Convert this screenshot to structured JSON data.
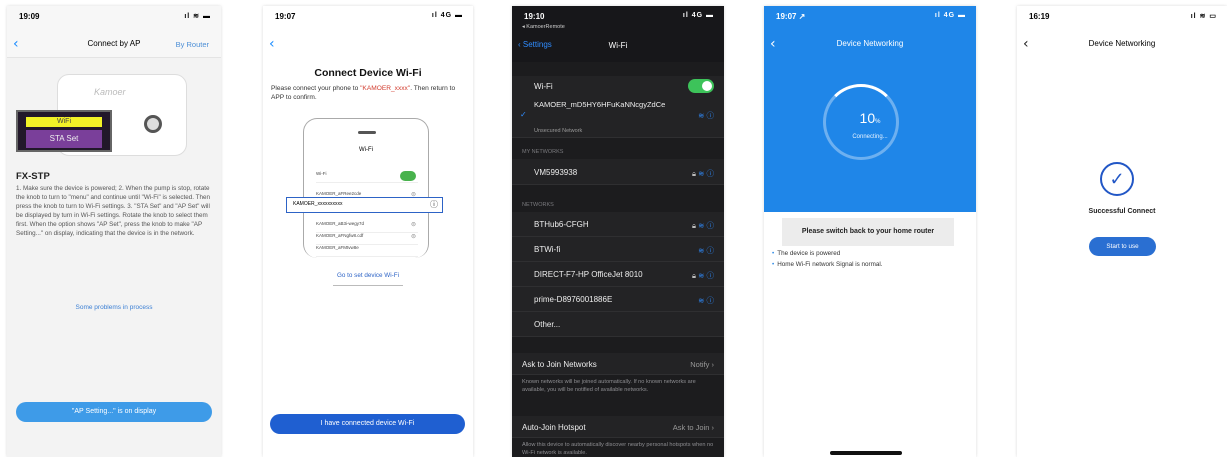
{
  "screen1": {
    "time": "19:09",
    "status_icons": "ıl ≋ ▬",
    "back": "‹",
    "title": "Connect by AP",
    "router_link": "By Router",
    "brand": "Kamoer",
    "lcd_wifi": "WiFi",
    "lcd_sta": "STA Set",
    "model": "FX-STP",
    "instructions": "1. Make sure the device is powered; 2. When the pump is stop, rotate the knob to turn to \"menu\" and continue until \"Wi-Fi\" is selected. Then press the knob to turn to Wi-Fi settings. 3. \"STA Set\" and \"AP Set\" will be displayed by turn in Wi-Fi settings. Rotate the knob to select them first. When the option shows \"AP Set\", press the knob to make \"AP Setting...\" on display, indicating that the device is in the network.",
    "problems_link": "Some problems in process",
    "button": "\"AP Setting...\" is on display"
  },
  "screen2": {
    "time": "19:07",
    "status_icons": "ıl 4G ▬",
    "back": "‹",
    "title": "Connect Device Wi-Fi",
    "desc_before": "Please connect your phone to ",
    "desc_red": "\"KAMOER_xxxx\"",
    "desc_after": ". Then return to APP to confirm.",
    "mock_title": "Wi-Fi",
    "mock_rows": [
      "Wi-Fi",
      "KAMOER_aFRee2cde",
      "KAMOER_aB3i-wegy7d",
      "KAMOER_aFNgfw8.cdf",
      "KAMOER_aFMtvw8e"
    ],
    "highlight_row": "KAMOER_xxxxxxxxxx",
    "go_link": "Go to set device Wi-Fi",
    "button": "I have connected device Wi-Fi"
  },
  "screen3": {
    "time": "19:10",
    "status_icons": "ıl 4G ▬",
    "remote": "◂ KamoerRemote",
    "settings": "‹ Settings",
    "title": "Wi-Fi",
    "wifi_label": "Wi-Fi",
    "connected_name": "KAMOER_mD5HY6HFuKaNNcgyZdCe",
    "connected_sub": "Unsecured Network",
    "my_networks_header": "MY NETWORKS",
    "my_networks": [
      "VM5993938"
    ],
    "networks_header": "NETWORKS",
    "networks": [
      "BTHub6-CFGH",
      "BTWi-fi",
      "DIRECT-F7-HP OfficeJet 8010",
      "prime-D8976001886E",
      "Other..."
    ],
    "ask_join_label": "Ask to Join Networks",
    "ask_join_value": "Notify ›",
    "ask_join_note": "Known networks will be joined automatically. If no known networks are available, you will be notified of available networks.",
    "hotspot_label": "Auto-Join Hotspot",
    "hotspot_value": "Ask to Join ›",
    "hotspot_note": "Allow this device to automatically discover nearby personal hotspots when no Wi-Fi network is available."
  },
  "screen4": {
    "time": "19:07 ↗",
    "status_icons": "ıl 4G ▬",
    "back": "‹",
    "title": "Device Networking",
    "percent": "10",
    "percent_unit": "%",
    "connecting": "Connecting...",
    "toast": "Please switch back to your home router",
    "bullet1": "The device is powered",
    "bullet2": "Home Wi-Fi network Signal is normal."
  },
  "screen5": {
    "time": "16:19",
    "status_icons": "ıl ≋ ▭",
    "back": "‹",
    "title": "Device Networking",
    "check": "✓",
    "success": "Successful Connect",
    "button": "Start to use"
  },
  "colors": {
    "accent_blue": "#2f8be6",
    "ios_green": "#3dc35a",
    "kamoer_red": "#d23c2e"
  }
}
